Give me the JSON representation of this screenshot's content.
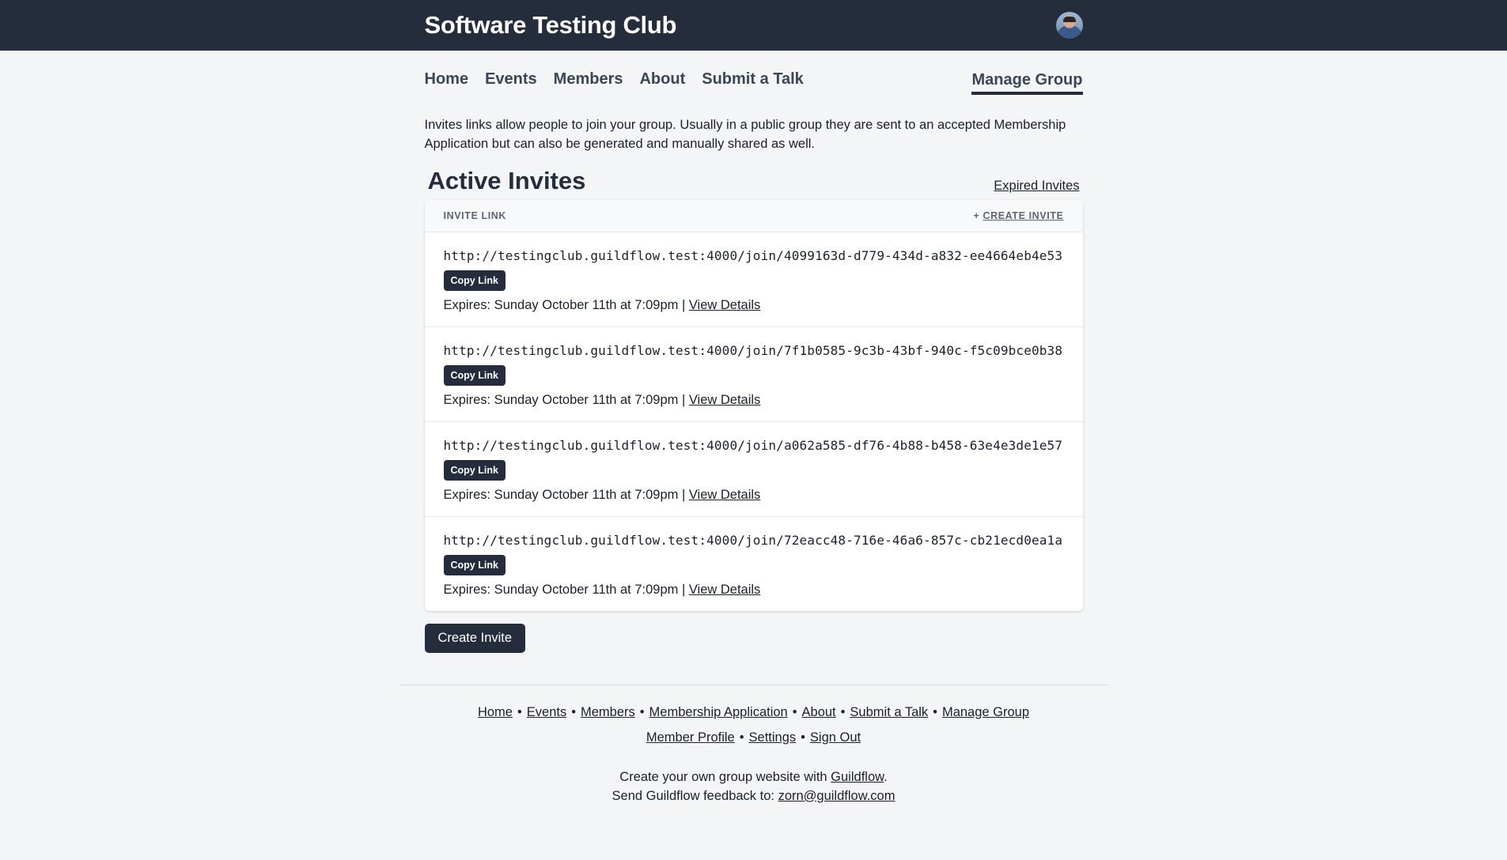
{
  "header": {
    "site_title": "Software Testing Club"
  },
  "nav": {
    "items": [
      {
        "label": "Home"
      },
      {
        "label": "Events"
      },
      {
        "label": "Members"
      },
      {
        "label": "About"
      },
      {
        "label": "Submit a Talk"
      }
    ],
    "manage_label": "Manage Group"
  },
  "intro": "Invites links allow people to join your group. Usually in a public group they are sent to an accepted Membership Application but can also be generated and manually shared as well.",
  "section": {
    "title": "Active Invites",
    "expired_link": "Expired Invites"
  },
  "table": {
    "column_label": "INVITE LINK",
    "create_prefix": "+ ",
    "create_label": "CREATE INVITE",
    "rows": [
      {
        "url": "http://testingclub.guildflow.test:4000/join/4099163d-d779-434d-a832-ee4664eb4e53",
        "copy_label": "Copy Link",
        "expires": "Expires: Sunday October 11th at 7:09pm | ",
        "details_label": "View Details"
      },
      {
        "url": "http://testingclub.guildflow.test:4000/join/7f1b0585-9c3b-43bf-940c-f5c09bce0b38",
        "copy_label": "Copy Link",
        "expires": "Expires: Sunday October 11th at 7:09pm | ",
        "details_label": "View Details"
      },
      {
        "url": "http://testingclub.guildflow.test:4000/join/a062a585-df76-4b88-b458-63e4e3de1e57",
        "copy_label": "Copy Link",
        "expires": "Expires: Sunday October 11th at 7:09pm | ",
        "details_label": "View Details"
      },
      {
        "url": "http://testingclub.guildflow.test:4000/join/72eacc48-716e-46a6-857c-cb21ecd0ea1a",
        "copy_label": "Copy Link",
        "expires": "Expires: Sunday October 11th at 7:09pm | ",
        "details_label": "View Details"
      }
    ]
  },
  "create_button": "Create Invite",
  "footer": {
    "links_line1": [
      "Home",
      "Events",
      "Members",
      "Membership Application",
      "About",
      "Submit a Talk",
      "Manage Group"
    ],
    "links_line2": [
      "Member Profile",
      "Settings",
      "Sign Out"
    ],
    "separator": "•",
    "credit_text": "Create your own group website with ",
    "credit_link": "Guildflow",
    "credit_end": ".",
    "feedback_text": "Send Guildflow feedback to: ",
    "feedback_email": "zorn@guildflow.com"
  },
  "colors": {
    "header_bg": "#252d3d",
    "page_bg": "#f4f5f7",
    "button_bg": "#252d3d"
  }
}
